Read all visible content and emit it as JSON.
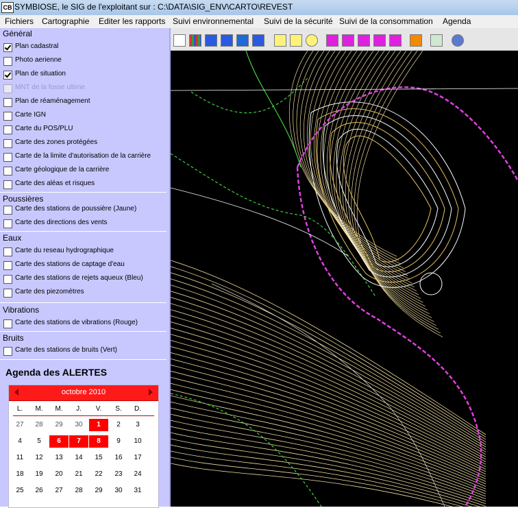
{
  "window": {
    "icon_text": "CB",
    "title": "SYMBIOSE, le SIG de l'exploitant sur : C:\\DATA\\SIG_ENV\\CARTO\\REVEST"
  },
  "menu": [
    "Fichiers",
    "Cartographie",
    "Editer les rapports",
    "Suivi environnemental",
    "Suivi de la sécurité",
    "Suivi de la consommation",
    "Agenda"
  ],
  "groups": {
    "general": {
      "title": "Général",
      "items": [
        {
          "label": "Plan cadastral",
          "checked": true
        },
        {
          "label": "Photo aerienne",
          "checked": false
        },
        {
          "label": "Plan de situation",
          "checked": true
        },
        {
          "label": "MNT de la fosse ultime",
          "checked": false,
          "disabled": true
        },
        {
          "label": "Plan de réaménagement",
          "checked": false
        },
        {
          "label": "Carte IGN",
          "checked": false
        },
        {
          "label": "Carte du POS/PLU",
          "checked": false
        },
        {
          "label": "Carte des zones protégées",
          "checked": false
        },
        {
          "label": "Carte de la limite d'autorisation de la carrière",
          "checked": false
        },
        {
          "label": "Carte géologique de la carrière",
          "checked": false
        },
        {
          "label": "Carte des aléas et risques",
          "checked": false
        }
      ]
    },
    "poussieres": {
      "title": "Poussières",
      "items": [
        {
          "label": "Carte des stations de poussière (Jaune)",
          "checked": false
        },
        {
          "label": "Carte des directions des vents",
          "checked": false
        }
      ]
    },
    "eaux": {
      "title": "Eaux",
      "items": [
        {
          "label": "Carte du reseau hydrographique",
          "checked": false
        },
        {
          "label": "Carte des stations de captage d'eau",
          "checked": false
        },
        {
          "label": "Carte des stations de rejets aqueux (Bleu)",
          "checked": false
        },
        {
          "label": "Carte des piezomètres",
          "checked": false
        }
      ]
    },
    "vibrations": {
      "title": "Vibrations",
      "items": [
        {
          "label": "Carte des stations de vibrations (Rouge)",
          "checked": false
        }
      ]
    },
    "bruits": {
      "title": "Bruits",
      "items": [
        {
          "label": "Carte des stations de bruits (Vert)",
          "checked": false
        }
      ]
    }
  },
  "agenda": {
    "title": "Agenda des ALERTES",
    "month": "octobre 2010",
    "weekdays": [
      "L.",
      "M.",
      "M.",
      "J.",
      "V.",
      "S.",
      "D."
    ],
    "weeks": [
      [
        "27",
        "28",
        "29",
        "30",
        "1",
        "2",
        "3"
      ],
      [
        "4",
        "5",
        "6",
        "7",
        "8",
        "9",
        "10"
      ],
      [
        "11",
        "12",
        "13",
        "14",
        "15",
        "16",
        "17"
      ],
      [
        "18",
        "19",
        "20",
        "21",
        "22",
        "23",
        "24"
      ],
      [
        "25",
        "26",
        "27",
        "28",
        "29",
        "30",
        "31"
      ]
    ],
    "highlighted": [
      "1",
      "6",
      "7",
      "8"
    ],
    "highlight_color": "#ff0000"
  },
  "toolbar": {
    "icons": [
      "layers-icon",
      "grid-icon",
      "zoom-in-icon",
      "zoom-out-icon",
      "pan-icon",
      "zoom-extent-icon",
      "scale-icon",
      "measure-icon",
      "clock-icon",
      "select-icon",
      "draw-icon",
      "edit-icon",
      "move-icon",
      "delete-icon",
      "orange-square-icon",
      "print-icon",
      "settings-icon"
    ]
  },
  "colors": {
    "panel": "#c8c8ff",
    "map_bg": "#000000",
    "contour": "#f0dca0",
    "boundary": "#e040e0",
    "green_line": "#40d040"
  }
}
